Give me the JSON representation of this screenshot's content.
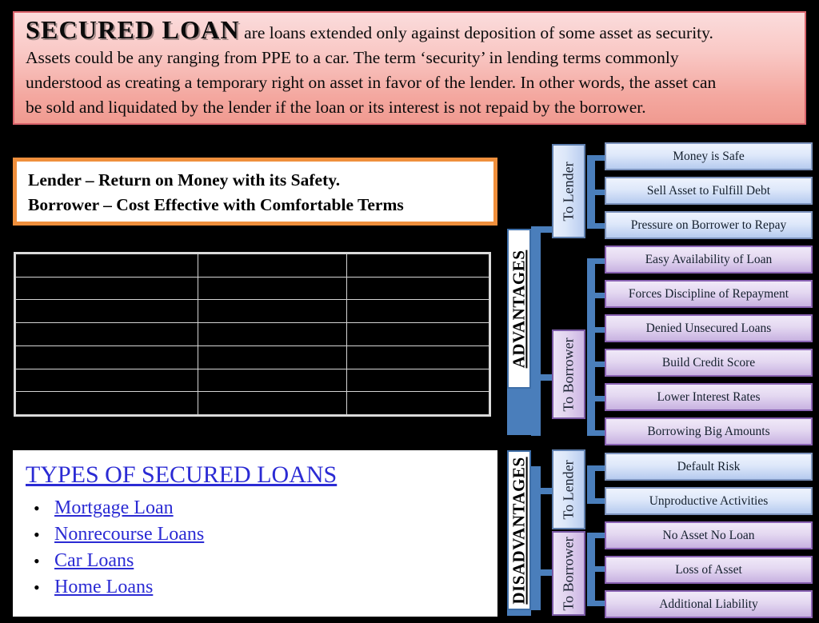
{
  "header": {
    "title": "SECURED LOAN",
    "intro": "are loans extended only against deposition of some asset as security.",
    "line2": "Assets could be any ranging from PPE to a car. The term ‘security’ in lending terms commonly",
    "line3": "understood as creating a temporary right on asset in favor of the lender. In other words, the asset can",
    "line4": "be sold and liquidated by the lender if the loan or its interest is not repaid by the borrower."
  },
  "summary_box": {
    "lender_line": "Lender – Return on Money with its Safety.",
    "borrower_line": "Borrower – Cost Effective with Comfortable Terms"
  },
  "table": {
    "rows": 7,
    "columns": 3,
    "cells": [
      [
        "",
        "",
        ""
      ],
      [
        "",
        "",
        ""
      ],
      [
        "",
        "",
        ""
      ],
      [
        "",
        "",
        ""
      ],
      [
        "",
        "",
        ""
      ],
      [
        "",
        "",
        ""
      ],
      [
        "",
        "",
        ""
      ]
    ]
  },
  "types": {
    "title": "TYPES OF SECURED LOANS",
    "bullet_glyph": "•",
    "items": [
      "Mortgage Loan",
      "Nonrecourse Loans",
      "Car Loans",
      "Home Loans"
    ]
  },
  "diagram": {
    "advantages": {
      "label": "ADVANTAGES",
      "to_lender_label": "To Lender",
      "to_borrower_label": "To Borrower",
      "lender_items": [
        "Money is Safe",
        "Sell Asset to Fulfill Debt",
        "Pressure on Borrower to Repay"
      ],
      "borrower_items": [
        "Easy Availability of Loan",
        "Forces Discipline of Repayment",
        "Denied Unsecured Loans",
        "Build Credit Score",
        "Lower Interest Rates",
        "Borrowing Big Amounts"
      ]
    },
    "disadvantages": {
      "label": "DISADVANTAGES",
      "to_lender_label": "To Lender",
      "to_borrower_label": "To Borrower",
      "lender_items": [
        "Default Risk",
        "Unproductive Activities"
      ],
      "borrower_items": [
        "No Asset No Loan",
        "Loss of Asset",
        "Additional Liability"
      ]
    }
  },
  "colors": {
    "header_gradient_top": "#fbdcdc",
    "header_gradient_bottom": "#f09a90",
    "header_border": "#d9636b",
    "summary_border": "#ef8f3c",
    "link_text": "#2b2bd4",
    "connector_blue": "#4a7ebb",
    "leaf_blue_border": "#7d93bd",
    "leaf_purple_border": "#8a63b4",
    "background": "#000000"
  }
}
